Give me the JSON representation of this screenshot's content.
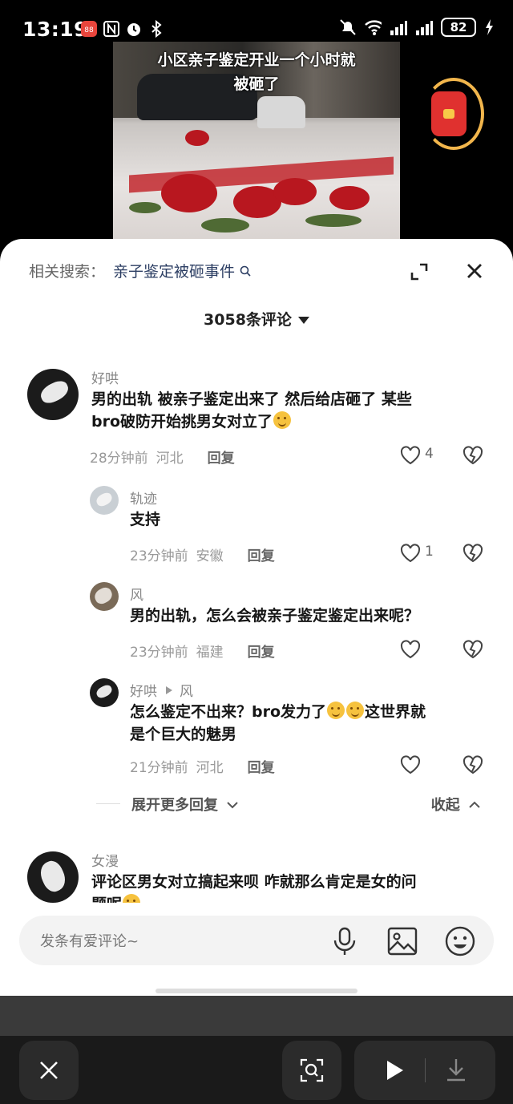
{
  "status_bar": {
    "time": "13:19",
    "left_icons": [
      "app-badge-icon",
      "nfc-icon",
      "alarm-icon",
      "bluetooth-icon"
    ],
    "right_icons": [
      "mute-icon",
      "wifi-icon",
      "signal-icon",
      "signal-icon"
    ],
    "battery": "82"
  },
  "video": {
    "caption_line1": "小区亲子鉴定开业一个小时就",
    "caption_line2": "被砸了"
  },
  "comments_sheet": {
    "related_label": "相关搜索：",
    "related_keyword": "亲子鉴定被砸事件",
    "count_label": "3058条评论"
  },
  "comments": [
    {
      "name": "好哄",
      "text_line1": "男的出轨 被亲子鉴定出来了 然后给店砸了 某些",
      "text_line2": "bro破防开始挑男女对立了",
      "time": "28分钟前",
      "location": "河北",
      "reply_label": "回复",
      "likes": "4"
    },
    {
      "name": "轨迹",
      "text_line1": "支持",
      "time": "23分钟前",
      "location": "安徽",
      "reply_label": "回复",
      "likes": "1"
    },
    {
      "name": "风",
      "text_line1": "男的出轨，怎么会被亲子鉴定鉴定出来呢？",
      "time": "23分钟前",
      "location": "福建",
      "reply_label": "回复",
      "likes": ""
    },
    {
      "name": "好哄",
      "reply_to": "风",
      "text_line1a": "怎么鉴定不出来？bro发力了",
      "text_line1b": "这世界就",
      "text_line2": "是个巨大的魅男",
      "time": "21分钟前",
      "location": "河北",
      "reply_label": "回复",
      "likes": ""
    },
    {
      "name": "女漫",
      "text_line1": "评论区男女对立搞起来呗 咋就那么肯定是女的问",
      "text_line2": "题呢"
    }
  ],
  "expand": {
    "more_label": "展开更多回复",
    "collapse_label": "收起"
  },
  "input": {
    "placeholder": "发条有爱评论~",
    "icons": [
      "microphone-icon",
      "image-icon",
      "emoji-icon"
    ]
  },
  "bottom_bar": {
    "icons": [
      "close-icon",
      "scan-icon",
      "play-icon",
      "download-icon"
    ]
  }
}
